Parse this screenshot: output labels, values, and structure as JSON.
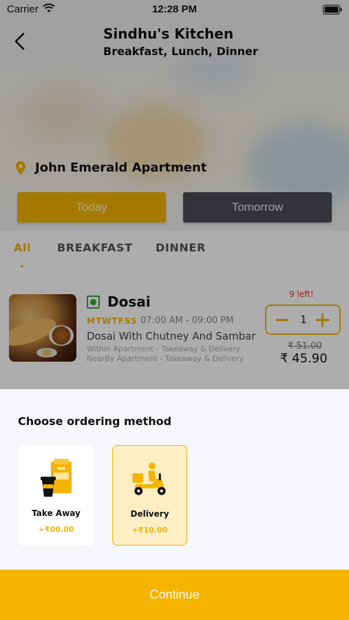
{
  "status_bar": {
    "carrier": "Carrier",
    "time": "12:28 PM"
  },
  "header": {
    "title": "Sindhu's Kitchen",
    "subtitle": "Breakfast, Lunch, Dinner",
    "back_icon": "chevron-left-icon"
  },
  "location": {
    "icon": "location-pin-icon",
    "name": "John Emerald Apartment"
  },
  "day_selector": {
    "today_label": "Today",
    "tomorrow_label": "Tomorrow",
    "selected": "Today"
  },
  "tabs": [
    {
      "label": "All",
      "active": true
    },
    {
      "label": "BREAKFAST",
      "active": false
    },
    {
      "label": "DINNER",
      "active": false
    }
  ],
  "food_item": {
    "name": "Dosai",
    "veg": true,
    "days": "MTWTFSS",
    "time": "07:00 AM - 09:00 PM",
    "description": "Dosai With Chutney And Sambar",
    "note_within": "Within Apartment - Takeaway & Delivery",
    "note_nearby": "NearBy Apartment - Takeaway & Delivery",
    "left_count": "9 left!",
    "quantity": "1",
    "old_price": "₹ 51.00",
    "price": "₹ 45.90"
  },
  "ordering_sheet": {
    "title": "Choose ordering method",
    "options": [
      {
        "label": "Take Away",
        "price": "+₹00.00",
        "icon": "takeaway-bag-cup-icon",
        "selected": false
      },
      {
        "label": "Delivery",
        "price": "+₹10.00",
        "icon": "delivery-scooter-icon",
        "selected": true
      }
    ],
    "continue_label": "Continue"
  },
  "colors": {
    "accent": "#f4b400",
    "dark_button": "#4a4d52",
    "veg_green": "#3aa53a",
    "warning_red": "#e53935"
  }
}
